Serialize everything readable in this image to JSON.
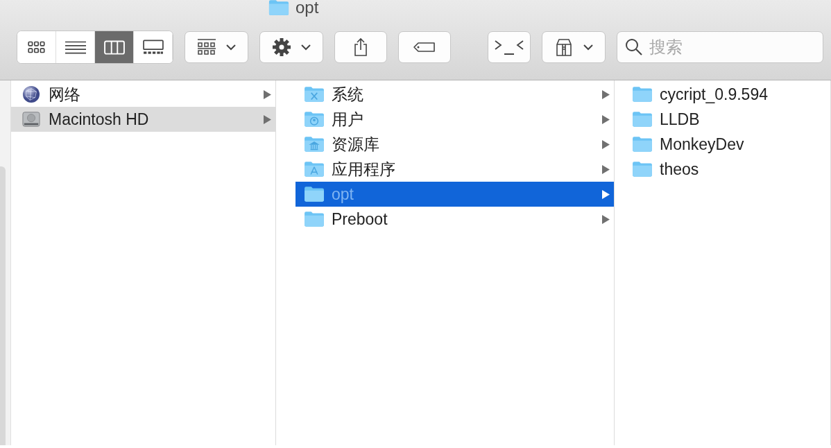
{
  "window": {
    "title": "opt"
  },
  "toolbar": {
    "views": [
      {
        "kind": "icons",
        "selected": false
      },
      {
        "kind": "list",
        "selected": false
      },
      {
        "kind": "columns",
        "selected": true
      },
      {
        "kind": "gallery",
        "selected": false
      }
    ],
    "search": {
      "placeholder": "搜索"
    }
  },
  "columns": [
    {
      "items": [
        {
          "kind": "network",
          "name": "网络",
          "selected": false,
          "expandable": true
        },
        {
          "kind": "disk",
          "name": "Macintosh HD",
          "selected": true,
          "expandable": true
        }
      ]
    },
    {
      "items": [
        {
          "kind": "system",
          "name": "系统",
          "selected": false,
          "expandable": true
        },
        {
          "kind": "users",
          "name": "用户",
          "selected": false,
          "expandable": true
        },
        {
          "kind": "library",
          "name": "资源库",
          "selected": false,
          "expandable": true
        },
        {
          "kind": "applications",
          "name": "应用程序",
          "selected": false,
          "expandable": true
        },
        {
          "kind": "folder",
          "name": "opt",
          "selected": true,
          "expandable": true
        },
        {
          "kind": "folder",
          "name": "Preboot",
          "selected": false,
          "expandable": true
        }
      ]
    },
    {
      "items": [
        {
          "kind": "folder",
          "name": "cycript_0.9.594",
          "selected": false,
          "expandable": false
        },
        {
          "kind": "folder",
          "name": "LLDB",
          "selected": false,
          "expandable": false
        },
        {
          "kind": "folder",
          "name": "MonkeyDev",
          "selected": false,
          "expandable": false
        },
        {
          "kind": "folder",
          "name": "theos",
          "selected": false,
          "expandable": false
        }
      ]
    }
  ]
}
